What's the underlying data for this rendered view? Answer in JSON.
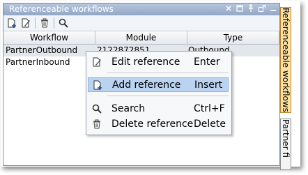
{
  "panel": {
    "title": "Referenceable workflows",
    "window_buttons": [
      "close",
      "maximize",
      "pin",
      "undock",
      "minimize"
    ]
  },
  "toolbar": {
    "buttons": [
      "add-icon",
      "edit-icon",
      "delete-icon",
      "search-icon"
    ]
  },
  "table": {
    "columns": [
      "Workflow",
      "Module",
      "Type"
    ],
    "rows": [
      {
        "workflow": "PartnerOutbound",
        "module": "2122872851",
        "type": "Outbound"
      },
      {
        "workflow": "PartnerInbound",
        "module": "",
        "type": ""
      }
    ]
  },
  "side_tabs": [
    {
      "label": "Referenceable workflows",
      "active": true
    },
    {
      "label": "Partner fi",
      "active": false
    }
  ],
  "context_menu": {
    "items": [
      {
        "label": "Edit reference",
        "shortcut": "Enter",
        "icon": "edit-icon"
      },
      {
        "label": "Add reference",
        "shortcut": "Insert",
        "icon": "add-icon",
        "highlighted": true
      },
      {
        "label": "Search",
        "shortcut": "Ctrl+F",
        "icon": "search-icon"
      },
      {
        "label": "Delete reference",
        "shortcut": "Delete",
        "icon": "delete-icon"
      }
    ]
  },
  "colors": {
    "titlebar": "#a4b8d2",
    "menu_highlight": "#b9d3f1",
    "active_tab": "#fde2a4"
  }
}
